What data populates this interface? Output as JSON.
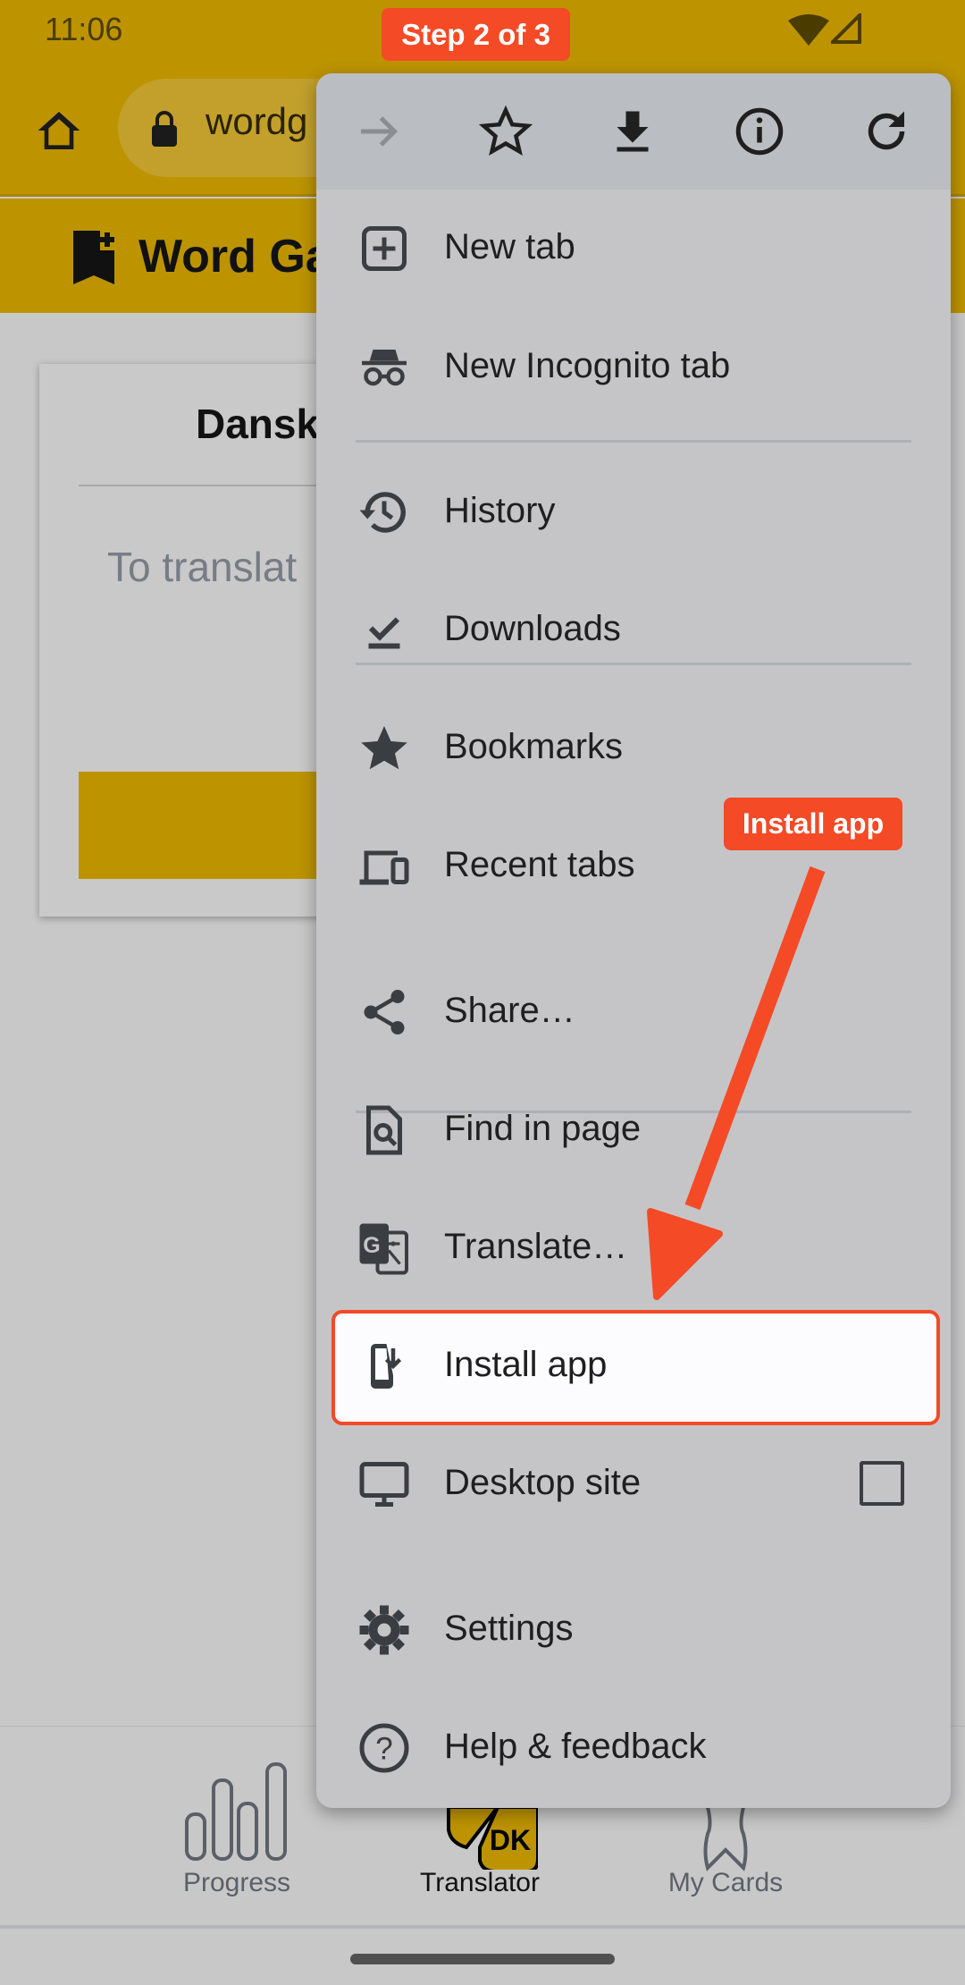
{
  "status_bar": {
    "time": "11:06",
    "icons": [
      "wifi-icon",
      "cell-signal-icon"
    ]
  },
  "browser": {
    "url_partial": "wordg",
    "icons": [
      "home-icon",
      "lock-icon"
    ]
  },
  "page": {
    "brand": "Word Ga",
    "card_title": "Dansk",
    "input_placeholder": "To translat"
  },
  "bottom_nav": [
    {
      "label": "Progress",
      "active": false
    },
    {
      "label": "Translator",
      "active": true,
      "badge": "DK"
    },
    {
      "label": "My Cards",
      "active": false
    }
  ],
  "menu": {
    "header_icons": [
      "forward-icon",
      "bookmark-star-icon",
      "download-icon",
      "info-icon",
      "reload-icon"
    ],
    "items": [
      {
        "label": "New tab",
        "icon": "new-tab-icon"
      },
      {
        "label": "New Incognito tab",
        "icon": "incognito-icon"
      },
      {
        "label": "History",
        "icon": "history-icon"
      },
      {
        "label": "Downloads",
        "icon": "downloads-icon"
      },
      {
        "label": "Bookmarks",
        "icon": "star-icon"
      },
      {
        "label": "Recent tabs",
        "icon": "devices-icon"
      },
      {
        "label": "Share…",
        "icon": "share-icon"
      },
      {
        "label": "Find in page",
        "icon": "find-in-page-icon"
      },
      {
        "label": "Translate…",
        "icon": "translate-icon"
      },
      {
        "label": "Install app",
        "icon": "install-app-icon",
        "highlighted": true
      },
      {
        "label": "Desktop site",
        "icon": "desktop-icon",
        "checked": false
      },
      {
        "label": "Settings",
        "icon": "settings-icon"
      },
      {
        "label": "Help & feedback",
        "icon": "help-icon"
      }
    ]
  },
  "overlay": {
    "step": "Step 2 of 3",
    "callout": "Install app"
  },
  "colors": {
    "brand": "#bd9400",
    "accent": "#f44a26",
    "menu_bg": "#c5c5c7"
  }
}
